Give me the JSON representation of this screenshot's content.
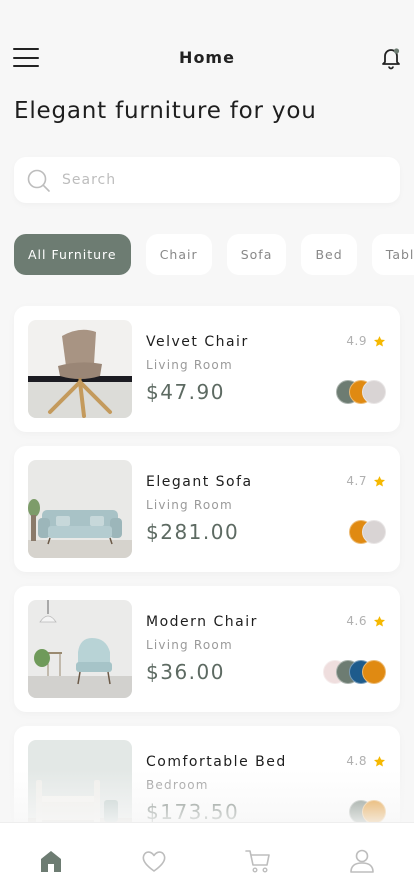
{
  "header": {
    "title": "Home",
    "menu_icon": "hamburger-menu-icon",
    "bell_icon": "bell-icon",
    "notification_color": "#6d7c72"
  },
  "heading": "Elegant furniture for you",
  "search": {
    "placeholder": "Search",
    "value": "",
    "icon": "search-icon"
  },
  "categories": [
    {
      "label": "All Furniture",
      "active": true
    },
    {
      "label": "Chair",
      "active": false
    },
    {
      "label": "Sofa",
      "active": false
    },
    {
      "label": "Bed",
      "active": false
    },
    {
      "label": "Table",
      "active": false
    }
  ],
  "products": [
    {
      "name": "Velvet Chair",
      "room": "Living Room",
      "price": "$47.90",
      "rating": "4.9",
      "colors": [
        "#6d7c72",
        "#e08a12",
        "#d9d4d4"
      ]
    },
    {
      "name": "Elegant Sofa",
      "room": "Living Room",
      "price": "$281.00",
      "rating": "4.7",
      "colors": [
        "#e08a12",
        "#d9d4d4"
      ]
    },
    {
      "name": "Modern Chair",
      "room": "Living Room",
      "price": "$36.00",
      "rating": "4.6",
      "colors": [
        "#efdede",
        "#6d7c72",
        "#1e5b8c",
        "#e08a12"
      ]
    },
    {
      "name": "Comfortable Bed",
      "room": "Bedroom",
      "price": "$173.50",
      "rating": "4.8",
      "colors": [
        "#6d7c72",
        "#e08a12"
      ]
    }
  ],
  "colors": {
    "accent": "#6d7c72",
    "star": "#f5b800"
  },
  "bottom_nav": [
    {
      "icon": "home-icon",
      "active": true
    },
    {
      "icon": "heart-icon",
      "active": false
    },
    {
      "icon": "cart-icon",
      "active": false
    },
    {
      "icon": "profile-icon",
      "active": false
    }
  ]
}
